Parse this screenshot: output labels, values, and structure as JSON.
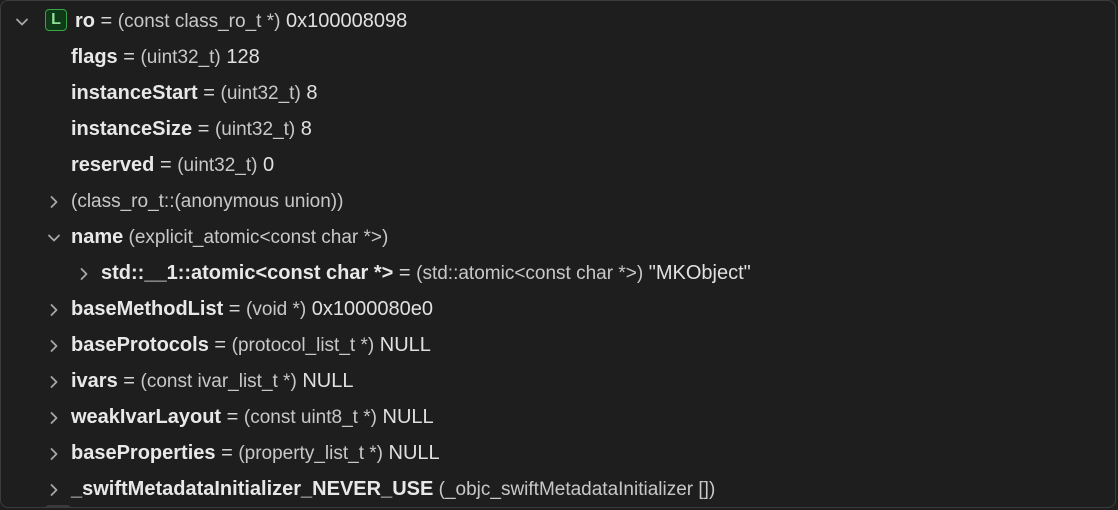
{
  "variables": [
    {
      "expanded": true,
      "badge": "L",
      "name": "ro",
      "eq": " = ",
      "type": "(const class_ro_t *)",
      "value": " 0x100008098"
    },
    {
      "name": "flags",
      "eq": " = ",
      "type": "(uint32_t)",
      "value": " 128"
    },
    {
      "name": "instanceStart",
      "eq": " = ",
      "type": "(uint32_t)",
      "value": " 8"
    },
    {
      "name": "instanceSize",
      "eq": " = ",
      "type": "(uint32_t)",
      "value": " 8"
    },
    {
      "name": "reserved",
      "eq": " = ",
      "type": "(uint32_t)",
      "value": " 0"
    },
    {
      "expanded": false,
      "type": "(class_ro_t::(anonymous union))"
    },
    {
      "expanded": true,
      "name": "name",
      "type": " (explicit_atomic<const char *>)"
    },
    {
      "expanded": false,
      "name": "std::__1::atomic<const char *>",
      "eq": " = ",
      "type": "(std::atomic<const char *>)",
      "value": " \"MKObject\""
    },
    {
      "expanded": false,
      "name": "baseMethodList",
      "eq": " = ",
      "type": "(void *)",
      "value": " 0x1000080e0"
    },
    {
      "expanded": false,
      "name": "baseProtocols",
      "eq": " = ",
      "type": "(protocol_list_t *)",
      "value": " NULL"
    },
    {
      "expanded": false,
      "name": "ivars",
      "eq": " = ",
      "type": "(const ivar_list_t *)",
      "value": " NULL"
    },
    {
      "expanded": false,
      "name": "weakIvarLayout",
      "eq": " = ",
      "type": "(const uint8_t *)",
      "value": " NULL"
    },
    {
      "expanded": false,
      "name": "baseProperties",
      "eq": " = ",
      "type": "(property_list_t *)",
      "value": " NULL"
    },
    {
      "expanded": false,
      "name": "_swiftMetadataInitializer_NEVER_USE",
      "type": " (_objc_swiftMetadataInitializer [])"
    }
  ]
}
